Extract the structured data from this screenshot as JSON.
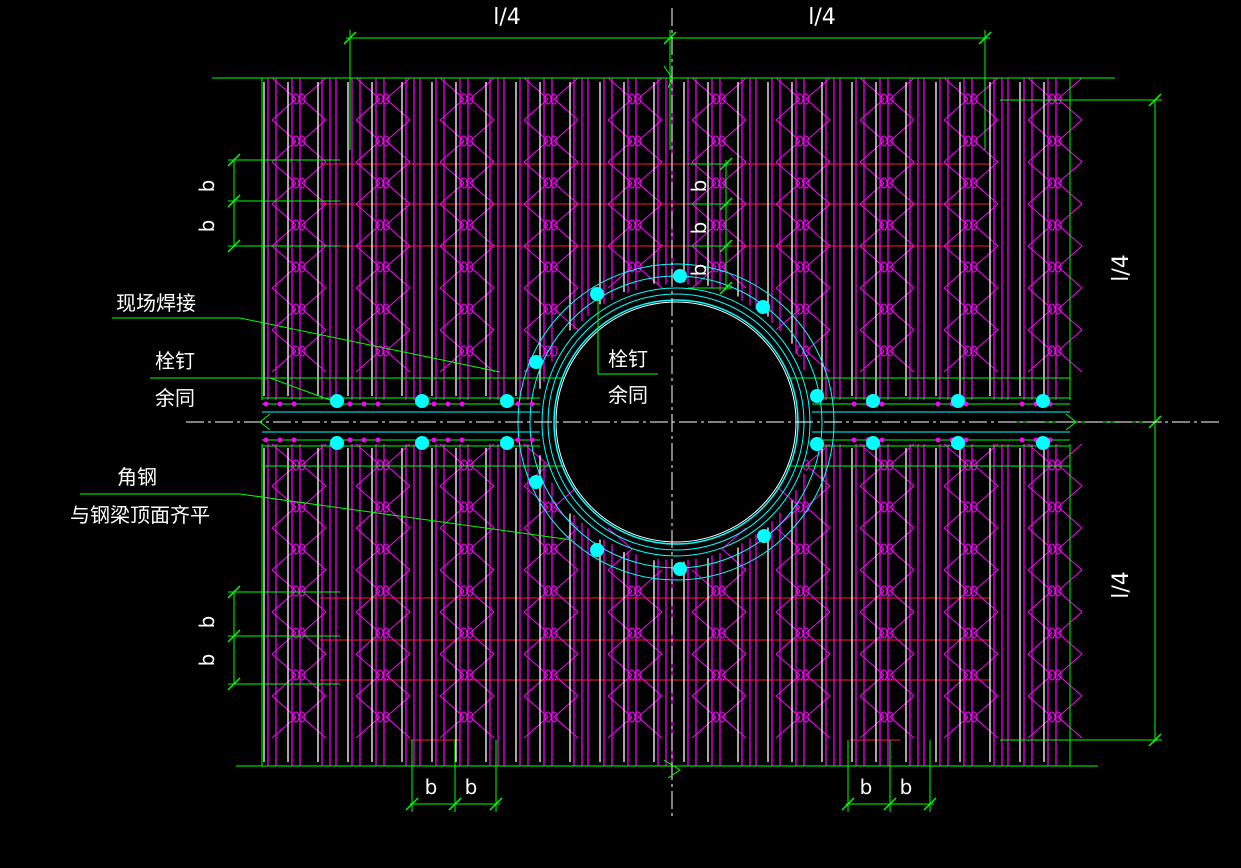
{
  "drawing": {
    "dimensions": {
      "quarter_span_top_left": "l/4",
      "quarter_span_top_right": "l/4",
      "quarter_span_right_upper": "l/4",
      "quarter_span_right_lower": "l/4",
      "spacing_b": "b"
    },
    "annotations": {
      "field_weld": "现场焊接",
      "stud_left_line1": "栓钉",
      "stud_left_line2": "余同",
      "stud_center_line1": "栓钉",
      "stud_center_line2": "余同",
      "angle_steel_line1": "角钢",
      "angle_steel_line2": "与钢梁顶面齐平"
    },
    "colors": {
      "background": "#000000",
      "truss": "#ff00ff",
      "dimension": "#00ff00",
      "circle": "#00ffff",
      "bar": "#ff2020",
      "rib": "#ffffff",
      "centerline": "#ffffff"
    }
  }
}
